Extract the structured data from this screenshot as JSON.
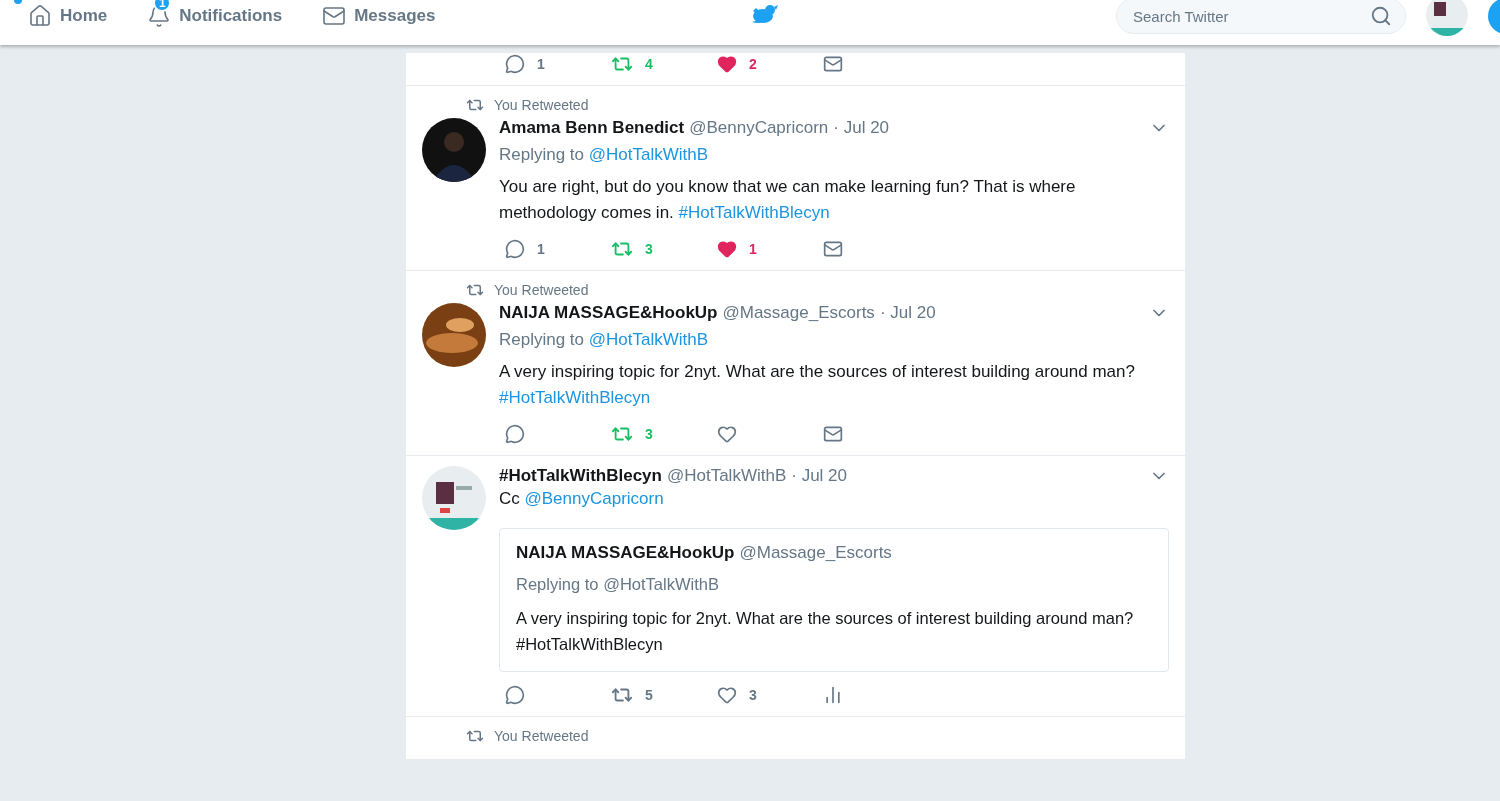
{
  "nav": {
    "items": [
      {
        "kind": "home",
        "label": "Home"
      },
      {
        "kind": "bell",
        "label": "Notifications",
        "badge": "1"
      },
      {
        "kind": "mail",
        "label": "Messages"
      }
    ],
    "search": {
      "placeholder": "Search Twitter"
    }
  },
  "feed": {
    "partial_actions": {
      "kind": "mail",
      "reply": "1",
      "retweet": "4",
      "retweeted": true,
      "like": "2",
      "liked": true
    },
    "tweets": [
      {
        "context": "You Retweeted",
        "name": "Amama Benn Benedict",
        "handle": "@BennyCapricorn",
        "date": "· Jul 20",
        "replying_label": "Replying to",
        "replying_to": "@HotTalkWithB",
        "text": [
          {
            "kind": "plain",
            "t": "You are right, but do you know that we can make learning fun? That is where methodology comes in. "
          },
          {
            "kind": "link",
            "t": "#HotTalkWithBlecyn"
          }
        ],
        "actions": {
          "kind": "mail",
          "reply": "1",
          "retweet": "3",
          "retweeted": true,
          "like": "1",
          "liked": true
        }
      },
      {
        "context": "You Retweeted",
        "name": "NAIJA MASSAGE&HookUp",
        "handle": "@Massage_Escorts",
        "date": "· Jul 20",
        "replying_label": "Replying to",
        "replying_to": "@HotTalkWithB",
        "text": [
          {
            "kind": "plain",
            "t": "A very inspiring topic for 2nyt. What are the sources of interest building around man? "
          },
          {
            "kind": "link",
            "t": "#HotTalkWithBlecyn"
          }
        ],
        "actions": {
          "kind": "mail",
          "retweet": "3",
          "retweeted": true,
          "liked": false
        }
      },
      {
        "name": "#HotTalkWithBlecyn",
        "handle": "@HotTalkWithB",
        "date": "· Jul 20",
        "text": [
          {
            "kind": "plain",
            "t": "Cc "
          },
          {
            "kind": "link",
            "t": "@BennyCapricorn"
          }
        ],
        "quote": {
          "name": "NAIJA MASSAGE&HookUp",
          "handle": "@Massage_Escorts",
          "replying": "Replying to @HotTalkWithB",
          "text": "A very inspiring topic for 2nyt. What are the sources of interest building around man? #HotTalkWithBlecyn"
        },
        "actions": {
          "kind": "analytics",
          "retweet": "5",
          "retweeted": false,
          "like": "3",
          "liked": false
        }
      }
    ],
    "next_context": "You Retweeted"
  }
}
